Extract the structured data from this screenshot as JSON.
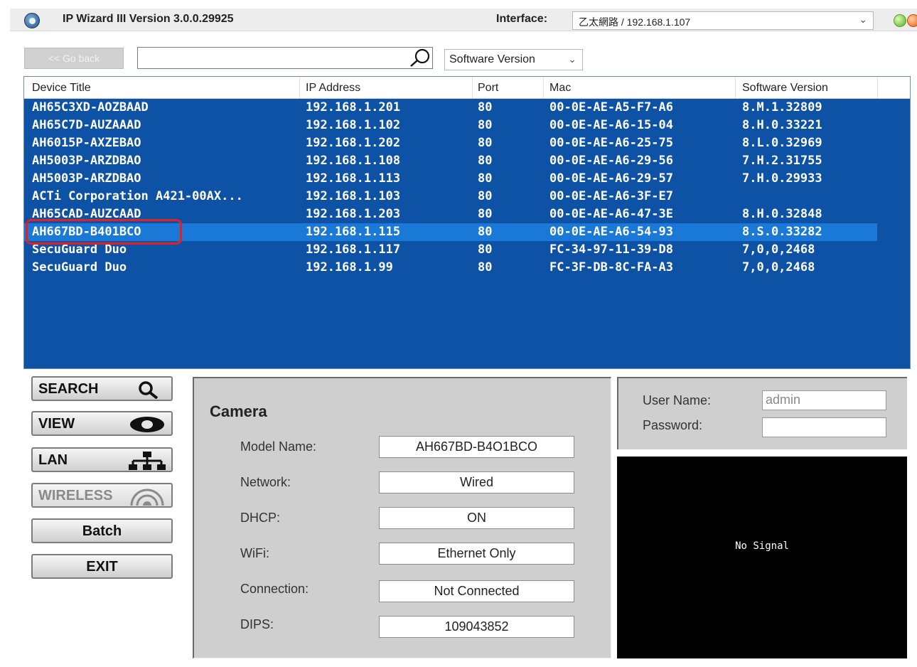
{
  "titlebar": {
    "title": "IP Wizard III Version 3.0.0.29925",
    "interface_label": "Interface:",
    "interface_value": "乙太網路 / 192.168.1.107"
  },
  "toolbar": {
    "go_back_label": "<< Go back",
    "search_value": "",
    "column_select": "Software Version"
  },
  "table": {
    "headers": [
      "Device Title",
      "IP Address",
      "Port",
      "Mac",
      "Software Version"
    ],
    "rows": [
      {
        "title": "AH65C3XD-AOZBAAD",
        "ip": "192.168.1.201",
        "port": "80",
        "mac": "00-0E-AE-A5-F7-A6",
        "version": "8.M.1.32809"
      },
      {
        "title": "AH65C7D-AUZAAAD",
        "ip": "192.168.1.102",
        "port": "80",
        "mac": "00-0E-AE-A6-15-04",
        "version": "8.H.0.33221"
      },
      {
        "title": "AH6015P-AXZEBAO",
        "ip": "192.168.1.202",
        "port": "80",
        "mac": "00-0E-AE-A6-25-75",
        "version": "8.L.0.32969"
      },
      {
        "title": "AH5003P-ARZDBAO",
        "ip": "192.168.1.108",
        "port": "80",
        "mac": "00-0E-AE-A6-29-56",
        "version": "7.H.2.31755"
      },
      {
        "title": "AH5003P-ARZDBAO",
        "ip": "192.168.1.113",
        "port": "80",
        "mac": "00-0E-AE-A6-29-57",
        "version": "7.H.0.29933"
      },
      {
        "title": "ACTi Corporation A421-00AX...",
        "ip": "192.168.1.103",
        "port": "80",
        "mac": "00-0E-AE-A6-3F-E7",
        "version": ""
      },
      {
        "title": "AH65CAD-AUZCAAD",
        "ip": "192.168.1.203",
        "port": "80",
        "mac": "00-0E-AE-A6-47-3E",
        "version": "8.H.0.32848"
      },
      {
        "title": "AH667BD-B401BCO",
        "ip": "192.168.1.115",
        "port": "80",
        "mac": "00-0E-AE-A6-54-93",
        "version": "8.S.0.33282"
      },
      {
        "title": "SecuGuard Duo",
        "ip": "192.168.1.117",
        "port": "80",
        "mac": "FC-34-97-11-39-D8",
        "version": "7,0,0,2468"
      },
      {
        "title": "SecuGuard Duo",
        "ip": "192.168.1.99",
        "port": "80",
        "mac": "FC-3F-DB-8C-FA-A3",
        "version": "7,0,0,2468"
      }
    ]
  },
  "sidebar": {
    "search": "SEARCH",
    "view": "VIEW",
    "lan": "LAN",
    "wireless": "WIRELESS",
    "batch": "Batch",
    "exit": "EXIT"
  },
  "camera": {
    "heading": "Camera",
    "model_label": "Model Name:",
    "model_value": "AH667BD-B4O1BCO",
    "network_label": "Network:",
    "network_value": "Wired",
    "dhcp_label": "DHCP:",
    "dhcp_value": "ON",
    "wifi_label": "WiFi:",
    "wifi_value": "Ethernet Only",
    "connection_label": "Connection:",
    "connection_value": "Not Connected",
    "dips_label": "DIPS:",
    "dips_value": "109043852"
  },
  "login": {
    "username_label": "User Name:",
    "username_value": "admin",
    "password_label": "Password:",
    "password_value": ""
  },
  "video": {
    "status": "No Signal"
  }
}
